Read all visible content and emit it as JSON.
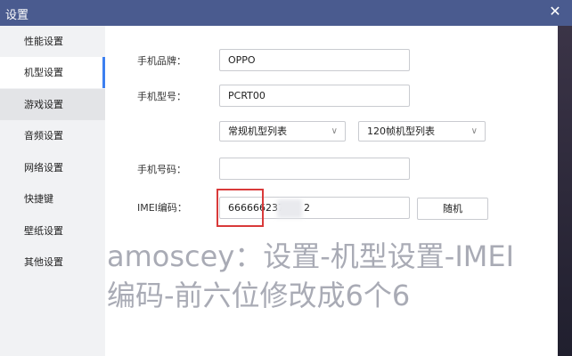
{
  "window": {
    "title": "设置",
    "close_glyph": "✕"
  },
  "sidebar": {
    "items": [
      {
        "label": "性能设置"
      },
      {
        "label": "机型设置"
      },
      {
        "label": "游戏设置"
      },
      {
        "label": "音频设置"
      },
      {
        "label": "网络设置"
      },
      {
        "label": "快捷键"
      },
      {
        "label": "壁纸设置"
      },
      {
        "label": "其他设置"
      }
    ],
    "active": "机型设置"
  },
  "form": {
    "brand": {
      "label": "手机品牌：",
      "value": "OPPO"
    },
    "model": {
      "label": "手机型号：",
      "value": "PCRT00"
    },
    "model_list_select": {
      "value": "常规机型列表"
    },
    "frame_list_select": {
      "value": "120帧机型列表"
    },
    "phone": {
      "label": "手机号码：",
      "value": ""
    },
    "imei": {
      "label": "IMEI编码：",
      "value_left": "666666237",
      "value_right": "2"
    },
    "random_button": {
      "label": "随机"
    }
  },
  "watermark": {
    "line1": "amoscey：设置-机型设置-IMEI",
    "line2": "编码-前六位修改成6个6"
  },
  "colors": {
    "titlebar": "#4a5b8f",
    "accent": "#3c7ff0",
    "highlight_box": "#d93a3a"
  }
}
